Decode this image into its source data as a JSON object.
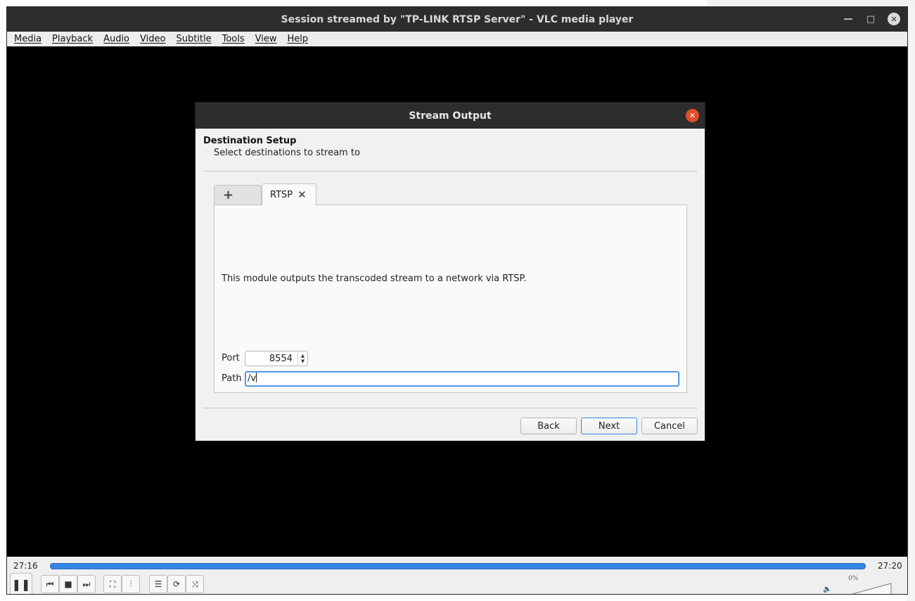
{
  "window": {
    "title": "Session streamed by \"TP-LINK RTSP Server\" - VLC media player",
    "min_glyph": "—",
    "max_glyph": "□",
    "close_glyph": "✕"
  },
  "menu": {
    "items": [
      "Media",
      "Playback",
      "Audio",
      "Video",
      "Subtitle",
      "Tools",
      "View",
      "Help"
    ]
  },
  "dialog": {
    "title": "Stream Output",
    "close_glyph": "✕",
    "heading": "Destination Setup",
    "subheading": "Select destinations to stream to",
    "tabs": {
      "add_glyph": "+",
      "active_label": "RTSP",
      "active_close_glyph": "✕"
    },
    "description": "This module outputs the transcoded stream to a network via RTSP.",
    "port_label": "Port",
    "port_value": "8554",
    "path_label": "Path",
    "path_value": "/v",
    "buttons": {
      "back": "Back",
      "next": "Next",
      "cancel": "Cancel"
    }
  },
  "player": {
    "elapsed": "27:16",
    "total": "27:20",
    "progress": 1.0,
    "volume_label": "0%",
    "icons": {
      "pause": "❚❚",
      "prev": "⏮",
      "stop": "■",
      "next": "⏭",
      "fullscreen": "⛶",
      "extended": "⫶",
      "playlist": "☰",
      "loop": "⟳",
      "shuffle": "⤨",
      "volume": "🔈"
    }
  },
  "colors": {
    "accent": "#3584e4",
    "close_button": "#e0502a",
    "titlebar": "#2d2d2d"
  }
}
